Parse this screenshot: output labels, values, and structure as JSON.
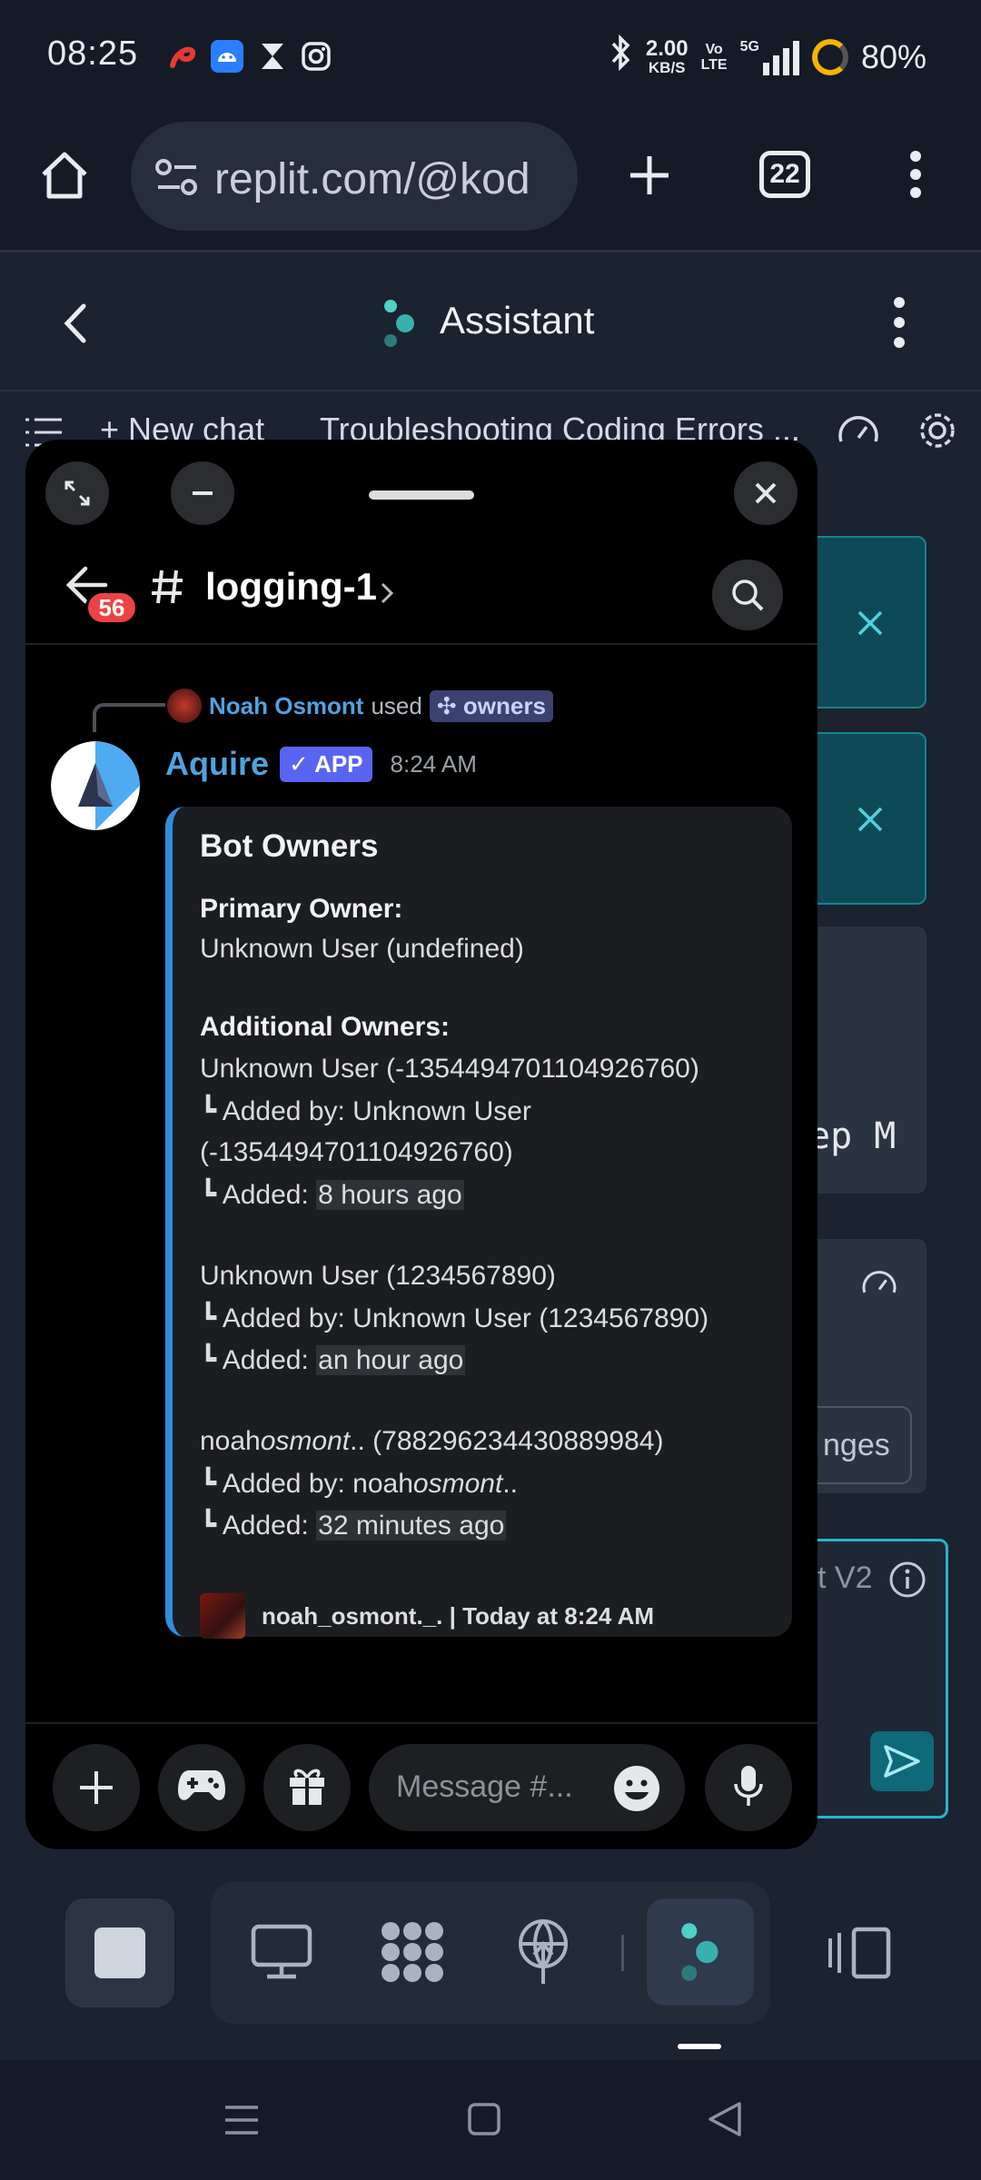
{
  "status": {
    "time": "08:25",
    "net_speed_value": "2.00",
    "net_speed_unit": "KB/S",
    "volte_top": "Vo",
    "volte_bottom": "LTE",
    "network": "5G",
    "battery": "80%"
  },
  "browser": {
    "url": "replit.com/@kod",
    "tab_count": "22"
  },
  "app": {
    "title": "Assistant",
    "new_chat_label": "New chat",
    "chat_title": "Troubleshooting Coding Errors ...",
    "bg_text_1": "ep M",
    "bg_text_2": "nges",
    "bg_text_3": "t V2"
  },
  "discord": {
    "unread_count": "56",
    "channel": "logging-1",
    "reply": {
      "user": "Noah Osmont",
      "verb": "used",
      "command": "owners"
    },
    "message": {
      "author": "Aquire",
      "tag": "APP",
      "time": "8:24 AM"
    },
    "embed": {
      "title": "Bot Owners",
      "primary_label": "Primary Owner:",
      "primary_value": "Unknown User (undefined)",
      "additional_label": "Additional Owners:",
      "o1_name": "Unknown User (-1354494701104926760)",
      "o1_added_by_prefix": "┗ Added by: Unknown User",
      "o1_added_by_cont": "(-1354494701104926760)",
      "o1_added_prefix": "┗ Added: ",
      "o1_added_when": "8 hours ago",
      "o2_name": "Unknown User (1234567890)",
      "o2_added_by": "┗ Added by: Unknown User (1234567890)",
      "o2_added_prefix": "┗ Added: ",
      "o2_added_when": "an hour ago",
      "o3_name_a": "noah",
      "o3_name_b": "osmont",
      "o3_name_c": ".. (788296234430889984)",
      "o3_added_by_a": "┗ Added by: noah",
      "o3_added_by_b": "osmont",
      "o3_added_by_c": "..",
      "o3_added_prefix": "┗ Added: ",
      "o3_added_when": "32 minutes ago",
      "footer": "noah_osmont._. | Today at 8:24 AM"
    },
    "composer_placeholder": "Message #..."
  }
}
